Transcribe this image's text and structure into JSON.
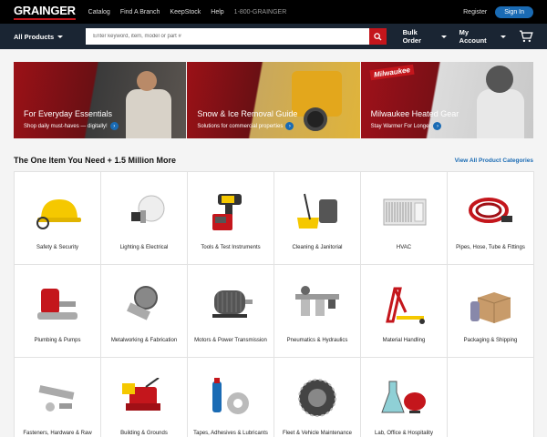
{
  "brand": {
    "logo": "GRAINGER",
    "accent": "#c4161c",
    "link_color": "#1a6bb4"
  },
  "top_nav": {
    "links": [
      "Catalog",
      "Find A Branch",
      "KeepStock",
      "Help"
    ],
    "phone": "1-800-GRAINGER",
    "register": "Register",
    "sign_in": "Sign In"
  },
  "main_nav": {
    "all_products": "All Products",
    "search_placeholder": "Enter keyword, item, model or part #",
    "bulk_order": "Bulk Order",
    "my_account": "My Account"
  },
  "banners": [
    {
      "title": "For Everyday Essentials",
      "subtitle": "Shop daily must-haves — digitally!"
    },
    {
      "title": "Snow & Ice Removal Guide",
      "subtitle": "Solutions for commercial properties"
    },
    {
      "title": "Milwaukee Heated Gear",
      "subtitle": "Stay Warmer For Longer",
      "badge": "Milwaukee"
    }
  ],
  "categories_section": {
    "title": "The One Item You Need + 1.5 Million More",
    "view_all": "View All Product Categories"
  },
  "categories": [
    {
      "name": "Safety & Security",
      "icon": "hard-hat-icon"
    },
    {
      "name": "Lighting & Electrical",
      "icon": "light-bulb-icon"
    },
    {
      "name": "Tools & Test Instruments",
      "icon": "drill-icon"
    },
    {
      "name": "Cleaning & Janitorial",
      "icon": "mop-bucket-icon"
    },
    {
      "name": "HVAC",
      "icon": "air-conditioner-icon"
    },
    {
      "name": "Pipes, Hose, Tube & Fittings",
      "icon": "hose-icon"
    },
    {
      "name": "Plumbing & Pumps",
      "icon": "pump-icon"
    },
    {
      "name": "Metalworking & Fabrication",
      "icon": "cutter-icon"
    },
    {
      "name": "Motors & Power Transmission",
      "icon": "motor-icon"
    },
    {
      "name": "Pneumatics & Hydraulics",
      "icon": "filter-regulator-icon"
    },
    {
      "name": "Material Handling",
      "icon": "hand-truck-icon"
    },
    {
      "name": "Packaging & Shipping",
      "icon": "box-icon"
    },
    {
      "name": "Fasteners, Hardware & Raw Materials",
      "icon": "fastener-icon"
    },
    {
      "name": "Building & Grounds Maintenance",
      "icon": "snow-blower-icon"
    },
    {
      "name": "Tapes, Adhesives & Lubricants",
      "icon": "tape-icon"
    },
    {
      "name": "Fleet & Vehicle Maintenance",
      "icon": "tire-chain-icon"
    },
    {
      "name": "Lab, Office & Hospitality Supplies",
      "icon": "lab-flask-icon"
    }
  ]
}
